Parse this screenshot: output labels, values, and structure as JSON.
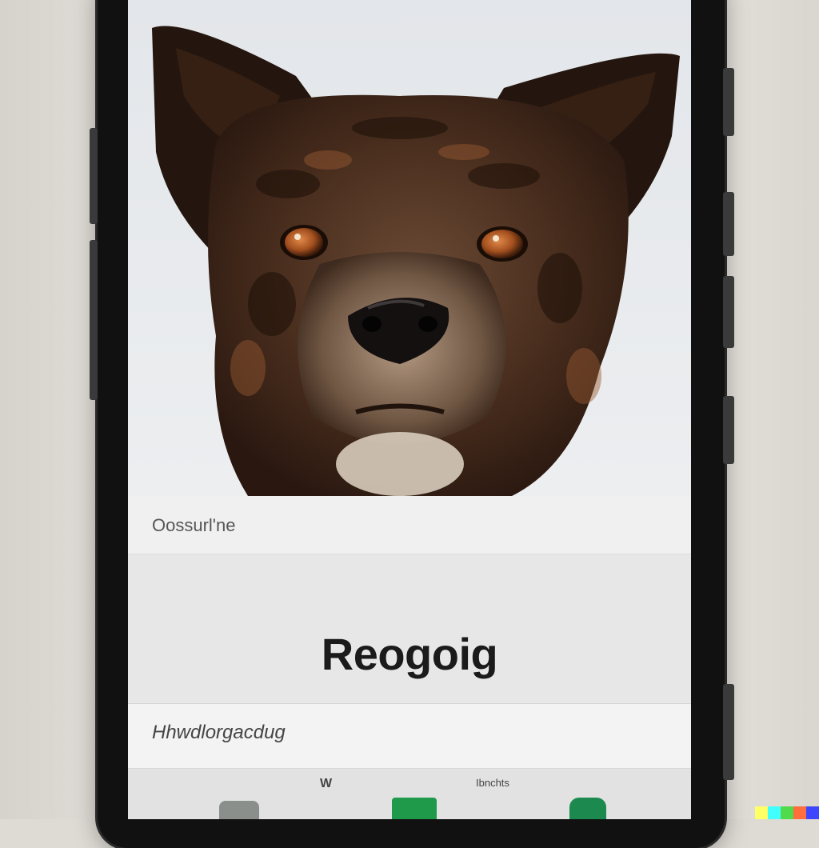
{
  "screen": {
    "row_top_label": "Oossurl'ne",
    "title": "Reogoig",
    "row_bottom_label": "Hhwdlorgacdug"
  },
  "bottom_bar": {
    "left_label": "W",
    "right_label": "Ibnchts",
    "icons": [
      {
        "name": "gray-app-icon",
        "color": "#8a8f8c"
      },
      {
        "name": "green-app-icon",
        "color": "#1f9a4a"
      },
      {
        "name": "teal-app-icon",
        "color": "#1c8a4f"
      }
    ]
  },
  "watermark_colors": [
    "#ffff66",
    "#42ffff",
    "#51da4c",
    "#ff6e3c",
    "#3c46ff"
  ]
}
